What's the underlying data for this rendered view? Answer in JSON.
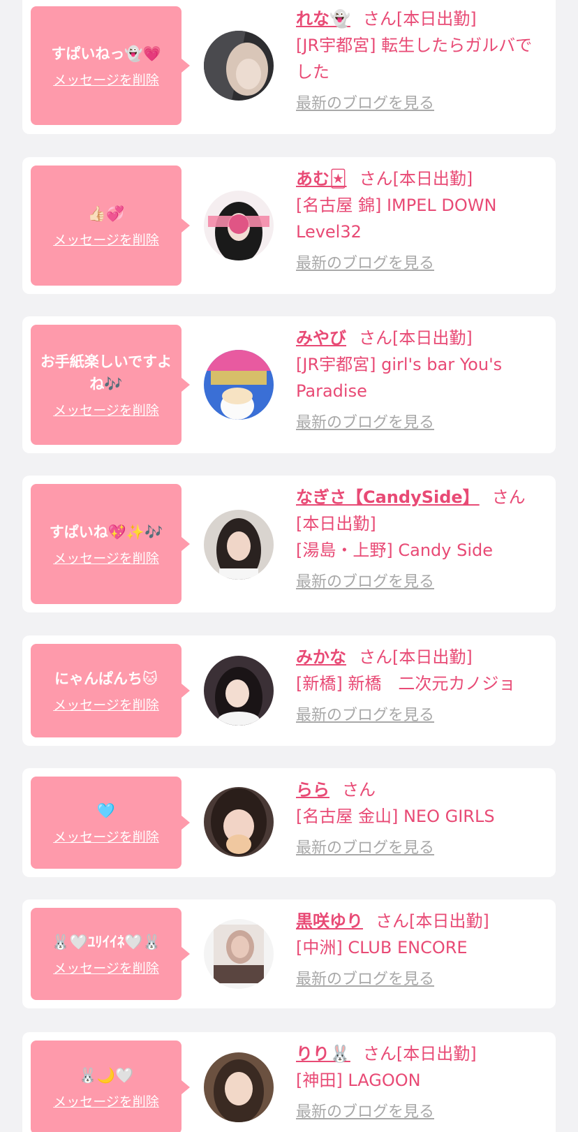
{
  "common": {
    "delete_label": "メッセージを削除",
    "san_label": "さん",
    "blog_label": "最新のブログを見る"
  },
  "items": [
    {
      "message": "すぱいねっ👻💗",
      "name": "れな👻",
      "status": "[本日出勤]",
      "shop": "[JR宇都宮] 転生したらガルバでした",
      "avatar_colors": [
        "#2d2d30",
        "#c9b8ad",
        "#e8d8cc"
      ]
    },
    {
      "message": "👍🏻💞",
      "name": "あむ🃏",
      "status": "[本日出勤]",
      "shop": "[名古屋 錦] IMPEL DOWN Level32",
      "avatar_colors": [
        "#1a1a1a",
        "#f48aa8",
        "#f2ddd4"
      ]
    },
    {
      "message": "お手紙楽しいですよね🎶",
      "name": "みやび",
      "status": "[本日出勤]",
      "shop": "[JR宇都宮] girl's bar You's Paradise",
      "avatar_colors": [
        "#3a6fd6",
        "#e85aa0",
        "#f7e3c3"
      ]
    },
    {
      "message": "すぱいね💖✨🎶",
      "name": "なぎさ【CandySide】",
      "status": "[本日出勤]",
      "shop": "[湯島・上野] Candy Side",
      "avatar_colors": [
        "#d9d4cf",
        "#2a2220",
        "#f0d6c8"
      ]
    },
    {
      "message": "にゃんぱんち🐱",
      "name": "みかな",
      "status": "[本日出勤]",
      "shop": "[新橋] 新橋　二次元カノジョ",
      "avatar_colors": [
        "#3b3036",
        "#1a1416",
        "#f3ddd1"
      ]
    },
    {
      "message": "🩵",
      "name": "らら",
      "status": "",
      "shop": "[名古屋 金山] NEO GIRLS",
      "avatar_colors": [
        "#4a3a36",
        "#2a1e1a",
        "#f0c8a0"
      ]
    },
    {
      "message": "🐰🤍ﾕﾘｲｲﾈ🤍🐰",
      "name": "黒咲ゆり",
      "status": "[本日出勤]",
      "shop": "[中洲] CLUB ENCORE",
      "avatar_colors": [
        "#f4f4f4",
        "#5a4540",
        "#e8c9bb"
      ]
    },
    {
      "message": "🐰🌙🤍",
      "name": "りり🐰",
      "status": "[本日出勤]",
      "shop": "[神田] LAGOON",
      "avatar_colors": [
        "#6b5140",
        "#3a2a22",
        "#f2d8c8"
      ]
    }
  ]
}
